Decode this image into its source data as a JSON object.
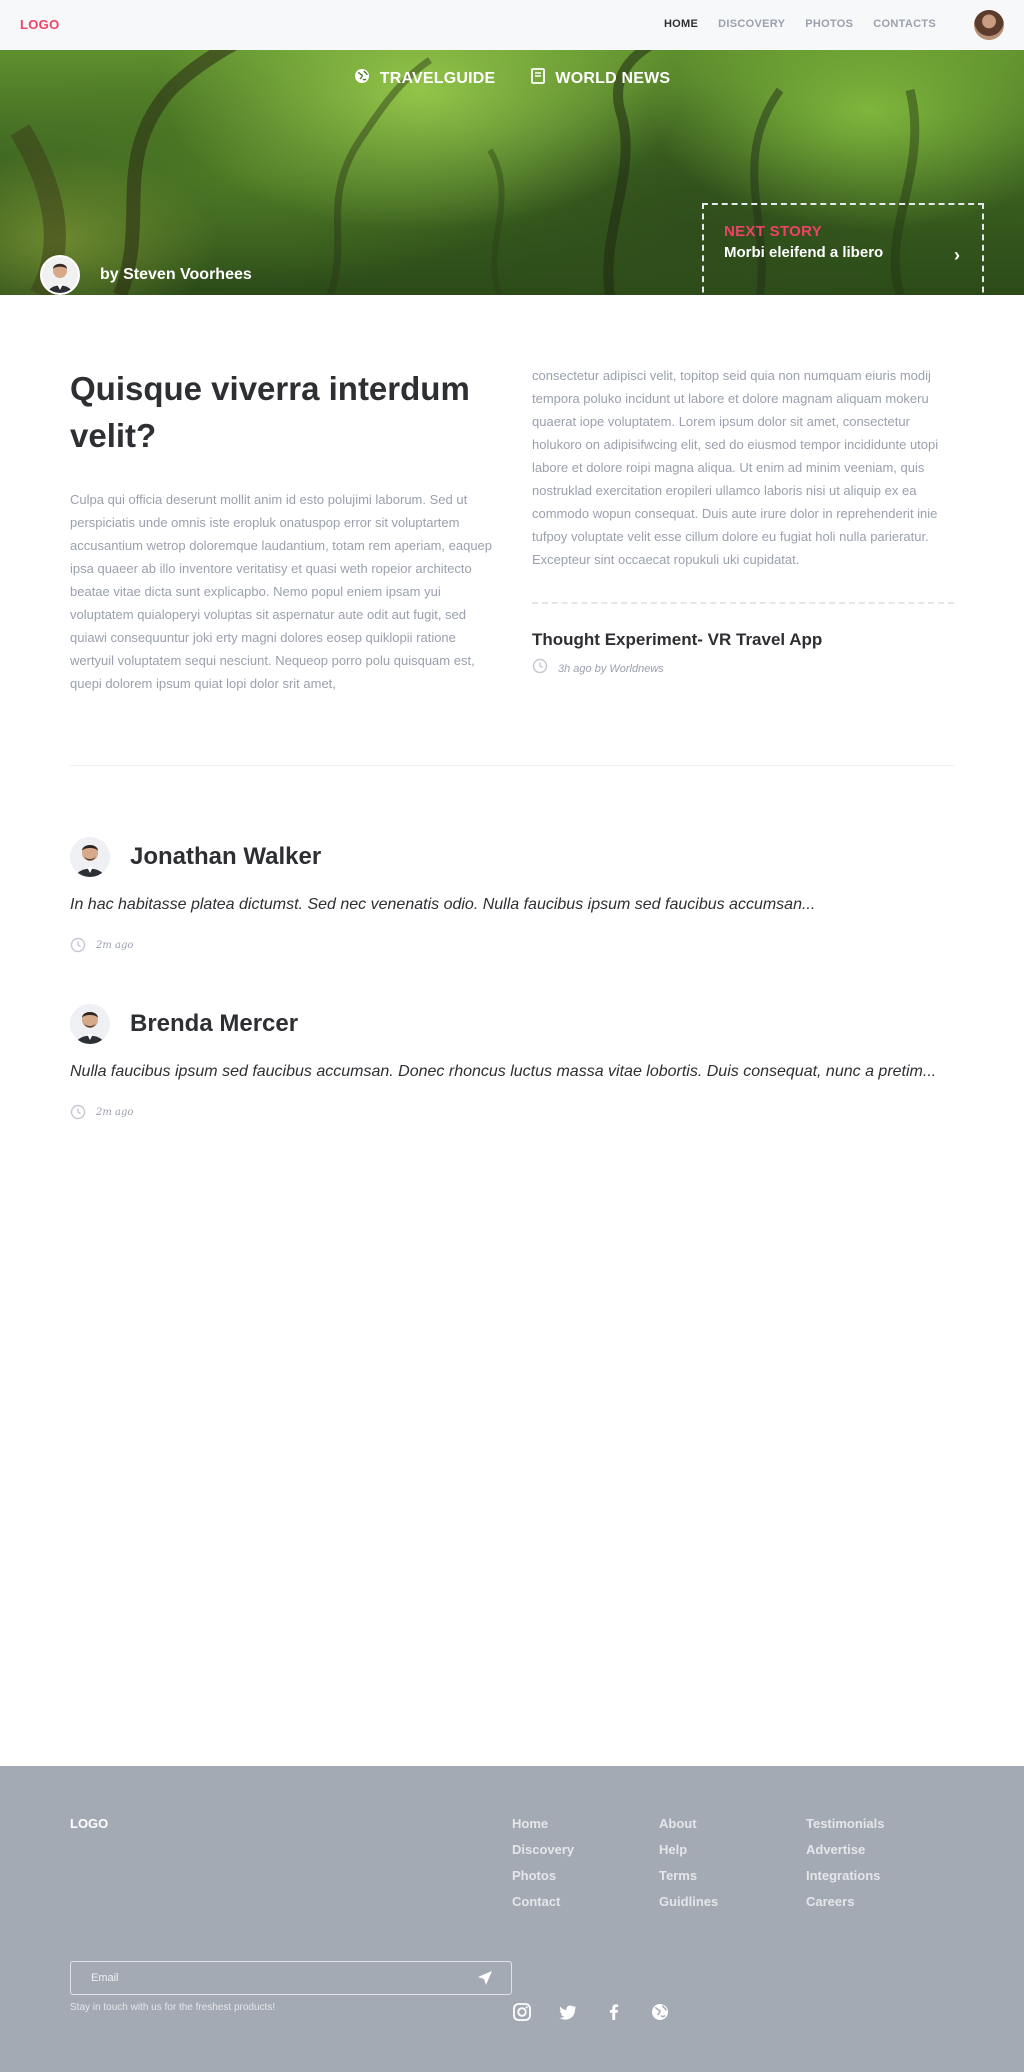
{
  "nav": {
    "logo": "LOGO",
    "links": [
      "HOME",
      "DISCOVERY",
      "PHOTOS",
      "CONTACTS"
    ],
    "active": "HOME"
  },
  "hero": {
    "categories": [
      {
        "label": "TRAVELGUIDE",
        "icon": "globe-icon"
      },
      {
        "label": "WORLD NEWS",
        "icon": "document-icon"
      }
    ],
    "author": "by Steven Voorhees",
    "next_story_label": "NEXT STORY",
    "next_story_title": "Morbi eleifend a libero"
  },
  "article": {
    "title": "Quisque viverra interdum velit?",
    "para_left": "Culpa qui officia deserunt mollit anim id esto polujimi laborum. Sed ut perspiciatis unde omnis iste eropluk onatuspop error sit voluptartem accusantium wetrop doloremque laudantium, totam rem aperiam, eaquep ipsa quaeer ab illo inventore veritatisy et quasi weth ropeior architecto beatae vitae dicta sunt explicapbo. Nemo popul eniem ipsam yui voluptatem quialoperyi voluptas sit aspernatur aute odit aut fugit, sed quiawi consequuntur joki erty magni dolores eosep quiklopii ratione wertyuil voluptatem sequi nesciunt. Nequeop porro polu quisquam est, quepi dolorem ipsum quiat lopi dolor srit amet,",
    "para_right": "consectetur adipisci velit, topitop seid quia non numquam eiuris modij tempora poluko incidunt ut labore et dolore magnam aliquam mokeru quaerat iope voluptatem. Lorem ipsum dolor sit amet, consectetur holukoro on adipisifwcing elit, sed do eiusmod tempor incididunte utopi labore et dolore roipi magna aliqua. Ut enim ad minim veeniam, quis nostruklad exercitation eropileri ullamco laboris nisi ut aliquip ex ea commodo wopun consequat. Duis aute irure dolor in reprehenderit inie tufpoy voluptate velit esse cillum dolore eu fugiat holi nulla parieratur. Excepteur sint occaecat ropukuli uki cupidatat.",
    "related_title": "Thought Experiment- VR Travel App",
    "related_meta": "3h ago by Worldnews"
  },
  "comments": [
    {
      "name": "Jonathan Walker",
      "text": "In hac habitasse platea dictumst. Sed nec venenatis odio. Nulla faucibus ipsum sed faucibus accumsan...",
      "time": "2m ago"
    },
    {
      "name": "Brenda Mercer",
      "text": "Nulla faucibus ipsum sed faucibus accumsan. Donec rhoncus luctus massa vitae lobortis. Duis consequat, nunc a pretim...",
      "time": "2m ago"
    }
  ],
  "footer": {
    "logo": "LOGO",
    "columns": [
      [
        "Home",
        "Discovery",
        "Photos",
        "Contact"
      ],
      [
        "About",
        "Help",
        "Terms",
        "Guidlines"
      ],
      [
        "Testimonials",
        "Advertise",
        "Integrations",
        "Careers"
      ]
    ],
    "email_placeholder": "Email",
    "note": "Stay in touch with us for the freshest products!",
    "social": [
      "instagram-icon",
      "twitter-icon",
      "facebook-icon",
      "globe-icon"
    ]
  },
  "colors": {
    "accent": "#ee4266",
    "footer_bg": "#a4aab3",
    "muted_text": "#9aa0ad",
    "heading_text": "#2d2f33"
  }
}
